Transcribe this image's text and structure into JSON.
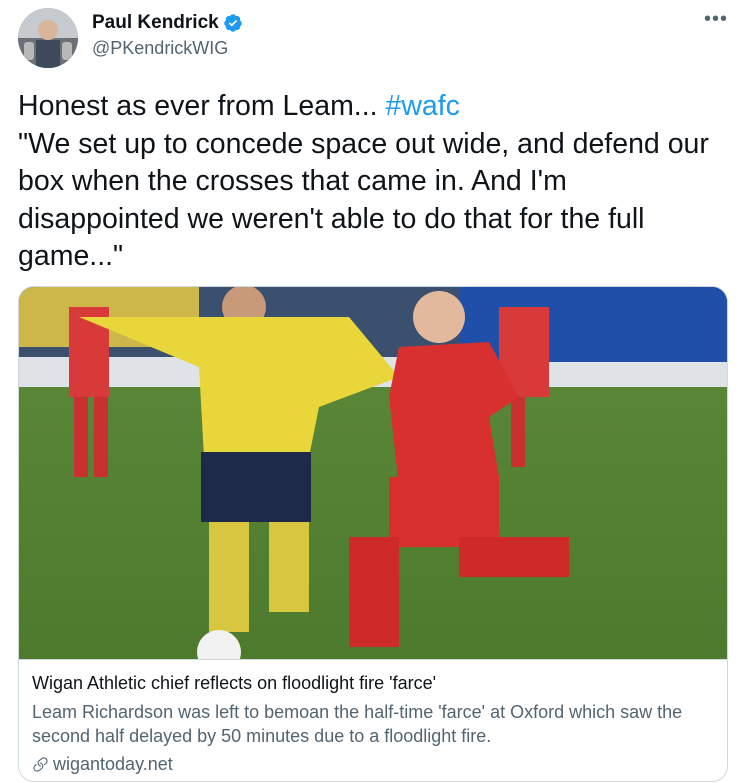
{
  "author": {
    "display_name": "Paul Kendrick",
    "handle": "@PKendrickWIG",
    "verified_icon": "verified-badge-icon",
    "avatar_icon": "user-avatar"
  },
  "tweet": {
    "line1_text": "Honest as ever from Leam... ",
    "hashtag": "#wafc",
    "quote": "\"We set up to concede space out wide, and defend our box when the crosses that came in. And I'm disappointed we weren't able to do that for the full game...\""
  },
  "card": {
    "title": "Wigan Athletic chief reflects on floodlight fire 'farce'",
    "description": "Leam Richardson was left to bemoan the half-time 'farce' at Oxford which saw the second half delayed by 50 minutes due to a floodlight fire.",
    "domain": "wigantoday.net",
    "image_icon": "football-match-photo",
    "link_icon": "link-icon"
  },
  "menu": {
    "more_label": "•••"
  },
  "colors": {
    "link": "#1d9bf0",
    "secondary_text": "#536471",
    "primary_text": "#0f1419",
    "border": "#cfd9de"
  }
}
